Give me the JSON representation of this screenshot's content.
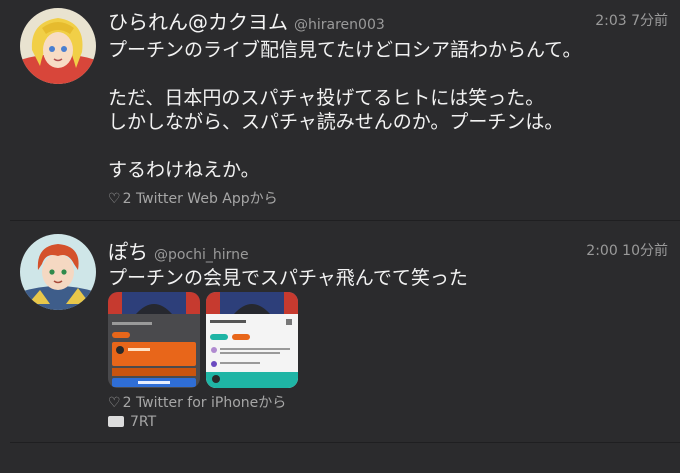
{
  "tweets": [
    {
      "name": "ひられん@カクヨム",
      "handle": "@hiraren003",
      "time": "2:03 7分前",
      "lines": [
        "プーチンのライブ配信見てたけどロシア語わからんて。",
        "",
        "ただ、日本円のスパチャ投げてるヒトには笑った。",
        "しかしながら、スパチャ読みせんのか。プーチンは。",
        "",
        "するわけねえか。"
      ],
      "likes": "2",
      "source": "Twitter Web Appから"
    },
    {
      "name": "ぽち",
      "handle": "@pochi_hirne",
      "time": "2:00 10分前",
      "lines": [
        "プーチンの会見でスパチャ飛んでて笑った"
      ],
      "likes": "2",
      "source": "Twitter for iPhoneから",
      "retweets": "7RT"
    }
  ],
  "icons": {
    "like": "heart-icon",
    "retweet": "retweet-icon"
  },
  "colors": {
    "background": "#2b2b2d",
    "text": "#f2f2f2",
    "muted": "#9a9a9a",
    "superchat_orange": "#e8661a",
    "superchat_teal": "#1fb5a5"
  }
}
